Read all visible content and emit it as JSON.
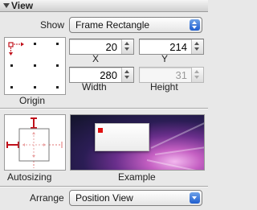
{
  "section": {
    "title": "View"
  },
  "show": {
    "label": "Show",
    "value": "Frame Rectangle"
  },
  "origin": {
    "label": "Origin"
  },
  "fields": {
    "x": {
      "value": "20",
      "label": "X"
    },
    "y": {
      "value": "214",
      "label": "Y"
    },
    "width": {
      "value": "280",
      "label": "Width"
    },
    "height": {
      "value": "31",
      "label": "Height",
      "enabled": false
    }
  },
  "autosizing": {
    "label": "Autosizing"
  },
  "example": {
    "label": "Example"
  },
  "arrange": {
    "label": "Arrange",
    "value": "Position View"
  },
  "colors": {
    "accent": "#1f5ecf",
    "strut": "#c0101a",
    "example_marker": "#e01010"
  }
}
